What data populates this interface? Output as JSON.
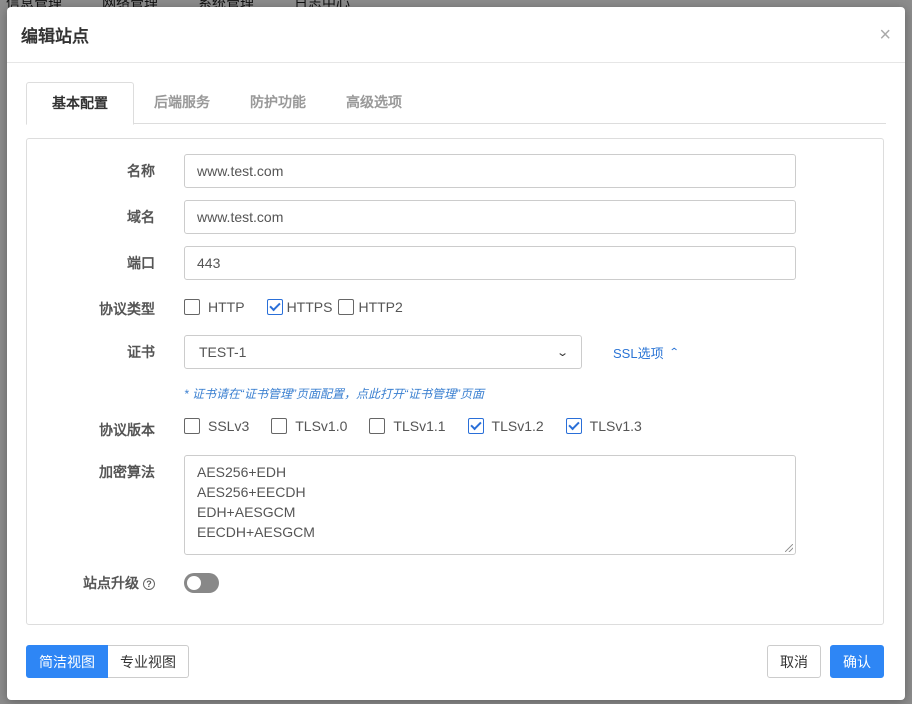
{
  "background": {
    "nav": [
      "信息管理",
      "网络管理",
      "系统管理",
      "日志中心"
    ]
  },
  "modal": {
    "title": "编辑站点",
    "close_label": "×"
  },
  "tabs": [
    {
      "label": "基本配置",
      "active": true
    },
    {
      "label": "后端服务",
      "active": false
    },
    {
      "label": "防护功能",
      "active": false
    },
    {
      "label": "高级选项",
      "active": false
    }
  ],
  "form": {
    "name_label": "名称",
    "name_value": "www.test.com",
    "domain_label": "域名",
    "domain_value": "www.test.com",
    "port_label": "端口",
    "port_value": "443",
    "protocol_type_label": "协议类型",
    "protocol_types": [
      {
        "label": "HTTP",
        "checked": false
      },
      {
        "label": "HTTPS",
        "checked": true
      },
      {
        "label": "HTTP2",
        "checked": false
      }
    ],
    "cert_label": "证书",
    "cert_value": "TEST-1",
    "ssl_options_label": "SSL选项",
    "cert_hint": "* 证书请在“证书管理”页面配置，点此打开“证书管理”页面",
    "protocol_version_label": "协议版本",
    "protocol_versions": [
      {
        "label": "SSLv3",
        "checked": false
      },
      {
        "label": "TLSv1.0",
        "checked": false
      },
      {
        "label": "TLSv1.1",
        "checked": false
      },
      {
        "label": "TLSv1.2",
        "checked": true
      },
      {
        "label": "TLSv1.3",
        "checked": true
      }
    ],
    "cipher_label": "加密算法",
    "ciphers": [
      "AES256+EDH",
      "AES256+EECDH",
      "EDH+AESGCM",
      "EECDH+AESGCM"
    ],
    "upgrade_label": "站点升级",
    "upgrade_help": "?",
    "upgrade_enabled": false
  },
  "footer": {
    "simple_view": "简洁视图",
    "pro_view": "专业视图",
    "cancel": "取消",
    "confirm": "确认"
  }
}
